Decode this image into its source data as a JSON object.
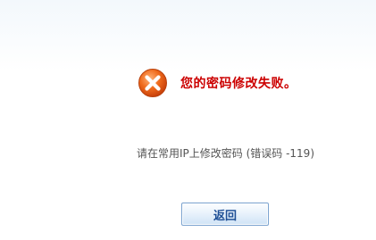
{
  "message": {
    "icon": "error-x-icon",
    "title": "您的密码修改失败。",
    "detail": "请在常用IP上修改密码 (错误码 -119)"
  },
  "actions": {
    "back_label": "返回"
  },
  "colors": {
    "title": "#cc0000",
    "icon_fill": "#e05a16",
    "button_text": "#1e4f96",
    "button_border": "#7aa2cf"
  }
}
